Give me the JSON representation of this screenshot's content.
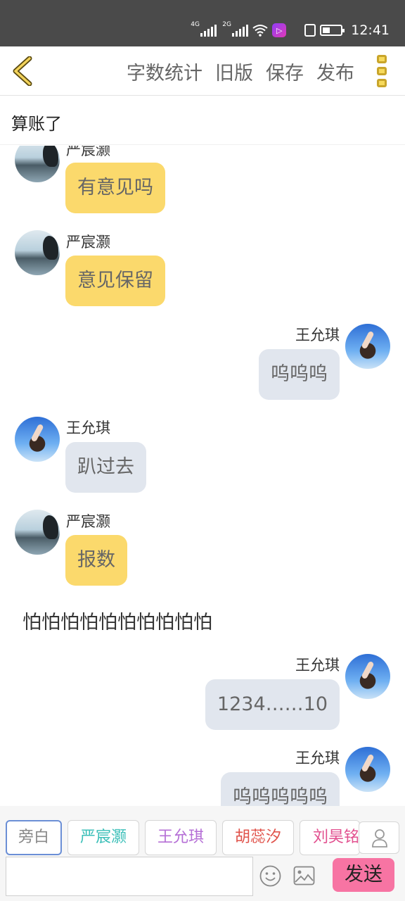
{
  "status_bar": {
    "network1": "4G",
    "network2": "2G",
    "time": "12:41"
  },
  "toolbar": {
    "word_count": "字数统计",
    "old_version": "旧版",
    "save": "保存",
    "publish": "发布"
  },
  "story_title": "算账了",
  "messages": [
    {
      "speaker": "严宸灏",
      "text": "有意见吗",
      "side": "left"
    },
    {
      "speaker": "严宸灏",
      "text": "意见保留",
      "side": "left"
    },
    {
      "speaker": "王允琪",
      "text": "呜呜呜",
      "side": "right"
    },
    {
      "speaker": "王允琪",
      "text": "趴过去",
      "side": "left"
    },
    {
      "speaker": "严宸灏",
      "text": "报数",
      "side": "left"
    },
    {
      "narration": "怕怕怕怕怕怕怕怕怕怕"
    },
    {
      "speaker": "王允琪",
      "text": "1234……10",
      "side": "right"
    },
    {
      "speaker": "王允琪",
      "text": "呜呜呜呜呜",
      "side": "right"
    }
  ],
  "roles": [
    {
      "label": "旁白",
      "color": "#888888"
    },
    {
      "label": "严宸灏",
      "color": "#3bbfb8"
    },
    {
      "label": "王允琪",
      "color": "#b56fd6"
    },
    {
      "label": "胡蕊汐",
      "color": "#e0524a"
    },
    {
      "label": "刘昊铭",
      "color": "#e2508f"
    }
  ],
  "input": {
    "value": "",
    "placeholder": ""
  },
  "send_label": "发送"
}
